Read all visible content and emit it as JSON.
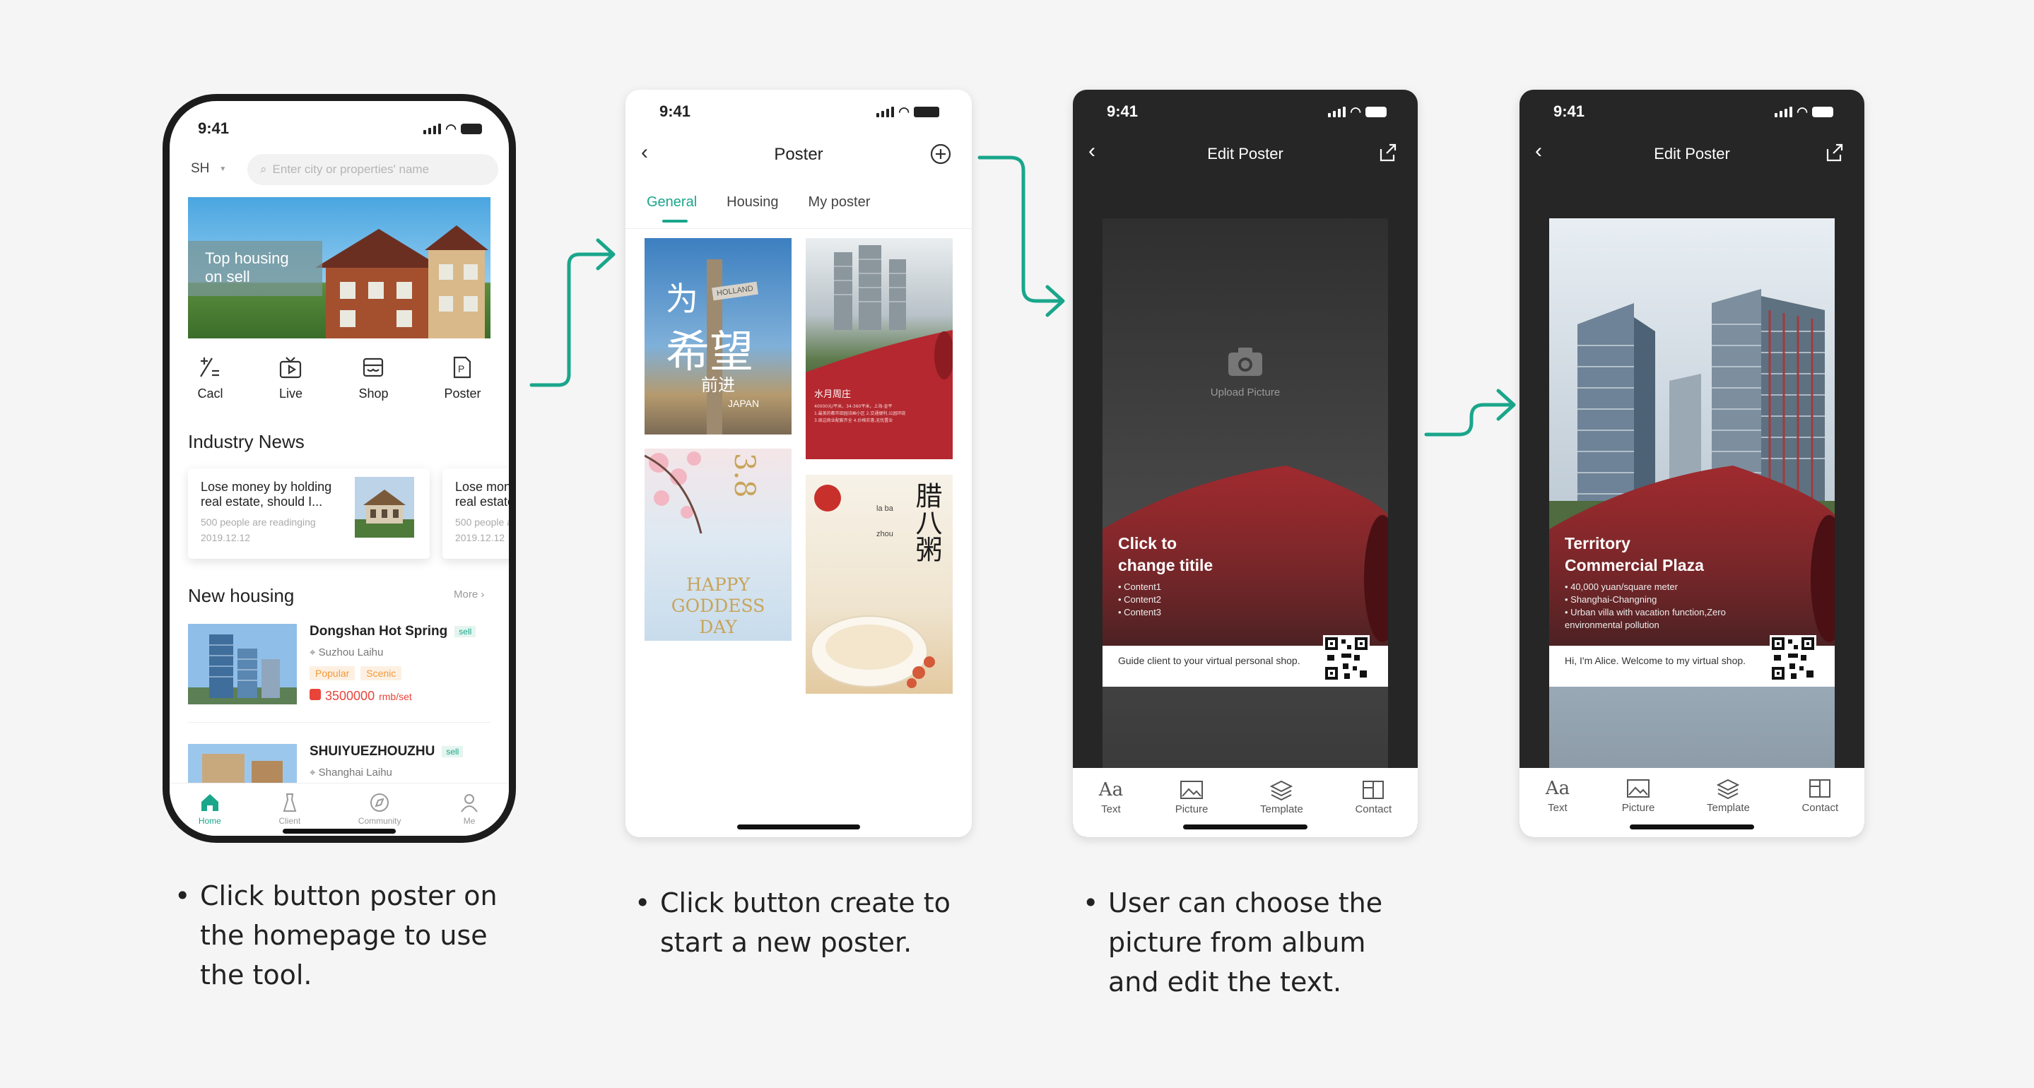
{
  "phone1": {
    "time": "9:41",
    "city": "SH",
    "search_placeholder": "Enter city or properties' name",
    "banner": "Top housing\non sell",
    "quick": [
      {
        "label": "Cacl",
        "icon": "calculator-icon"
      },
      {
        "label": "Live",
        "icon": "tv-icon"
      },
      {
        "label": "Shop",
        "icon": "shop-icon"
      },
      {
        "label": "Poster",
        "icon": "poster-icon"
      }
    ],
    "news_title": "Industry News",
    "news": [
      {
        "title": "Lose money by holding real estate, should I...",
        "readers": "500 people are readinging",
        "date": "2019.12.12"
      },
      {
        "title": "Lose money by holding real estate, should I...",
        "readers": "500 people are readinging",
        "date": "2019.12.12"
      }
    ],
    "housing_title": "New housing",
    "more": "More",
    "listings": [
      {
        "name": "Dongshan Hot Spring",
        "tag": "sell",
        "location": "Suzhou Laihu",
        "labels": [
          "Popular",
          "Scenic"
        ],
        "price": "3500000",
        "unit": "rmb/set"
      },
      {
        "name": "SHUIYUEZHOUZHU",
        "tag": "sell",
        "location": "Shanghai Laihu"
      }
    ],
    "tabs": [
      {
        "label": "Home",
        "icon": "home-icon"
      },
      {
        "label": "Client",
        "icon": "client-icon"
      },
      {
        "label": "Community",
        "icon": "compass-icon"
      },
      {
        "label": "Me",
        "icon": "person-icon"
      }
    ]
  },
  "phone2": {
    "time": "9:41",
    "title": "Poster",
    "tabs": [
      "General",
      "Housing",
      "My poster"
    ],
    "poster1": {
      "cn1": "为",
      "cn2": "希望",
      "cn3": "前进",
      "tag1": "HOLLAND",
      "tag2": "JAPAN"
    },
    "poster2": {
      "cn": "水月周庄",
      "body": "40000元/平米，34-360平米，上海-金平\n1.最美的都市田园诗画小区 2.交通便利,公园环绕\n3.周边商业配套齐全 4.价格实惠,无忧置业"
    },
    "poster3": {
      "num": "3.8",
      "text": "HAPPY\nGODDESS\nDAY"
    },
    "poster4": {
      "chars": "腊八粥",
      "pinyin": "la ba zhou"
    }
  },
  "phone3": {
    "time": "9:41",
    "title": "Edit Poster",
    "upload": "Upload Picture",
    "heading": "Click to\nchange titile",
    "bullets": [
      "Content1",
      "Content2",
      "Content3"
    ],
    "footer": "Guide client to your virtual personal shop.",
    "tools": [
      {
        "label": "Text",
        "icon": "text-icon"
      },
      {
        "label": "Picture",
        "icon": "picture-icon"
      },
      {
        "label": "Template",
        "icon": "layers-icon"
      },
      {
        "label": "Contact",
        "icon": "contact-icon"
      }
    ]
  },
  "phone4": {
    "time": "9:41",
    "title": "Edit Poster",
    "heading": "Territory\nCommercial Plaza",
    "bullets": [
      "40,000 yuan/square meter",
      "Shanghai-Changning",
      "Urban villa with vacation function,Zero environmental pollution"
    ],
    "footer": "Hi, I'm Alice. Welcome to my virtual shop.",
    "tools": [
      {
        "label": "Text",
        "icon": "text-icon"
      },
      {
        "label": "Picture",
        "icon": "picture-icon"
      },
      {
        "label": "Template",
        "icon": "layers-icon"
      },
      {
        "label": "Contact",
        "icon": "contact-icon"
      }
    ]
  },
  "captions": {
    "c1": "Click button poster on the homepage to use the tool.",
    "c2": "Click button create to start a new poster.",
    "c3": "User can choose the picture from album and edit the text."
  },
  "colors": {
    "accent": "#1aa68b",
    "price": "#e8443a",
    "dark": "#262626"
  }
}
